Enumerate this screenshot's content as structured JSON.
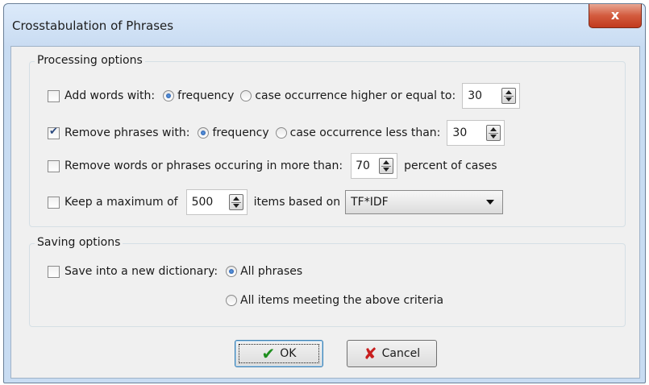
{
  "window": {
    "title": "Crosstabulation of Phrases",
    "close_glyph": "x"
  },
  "processing": {
    "legend": "Processing options",
    "add_words": {
      "checked": false,
      "label": "Add words with:",
      "radio_frequency": "frequency",
      "radio_case": "case occurrence higher or equal to:",
      "selected": "frequency",
      "value": "30"
    },
    "remove_phrases": {
      "checked": true,
      "label": "Remove phrases with:",
      "radio_frequency": "frequency",
      "radio_case": "case occurrence less than:",
      "selected": "frequency",
      "value": "30"
    },
    "remove_common": {
      "checked": false,
      "label": "Remove words or phrases occuring in more than:",
      "value": "70",
      "suffix": "percent of cases"
    },
    "keep_max": {
      "checked": false,
      "label": "Keep a maximum of",
      "value": "500",
      "middle": "items based on",
      "combo_value": "TF*IDF"
    }
  },
  "saving": {
    "legend": "Saving options",
    "save_new": {
      "checked": false,
      "label": "Save into a new dictionary:",
      "radio_all": "All phrases",
      "radio_criteria": "All items meeting the above criteria",
      "selected": "all"
    }
  },
  "buttons": {
    "ok": "OK",
    "cancel": "Cancel"
  },
  "icons": {
    "ok": "checkmark-icon",
    "cancel": "red-x-icon"
  }
}
